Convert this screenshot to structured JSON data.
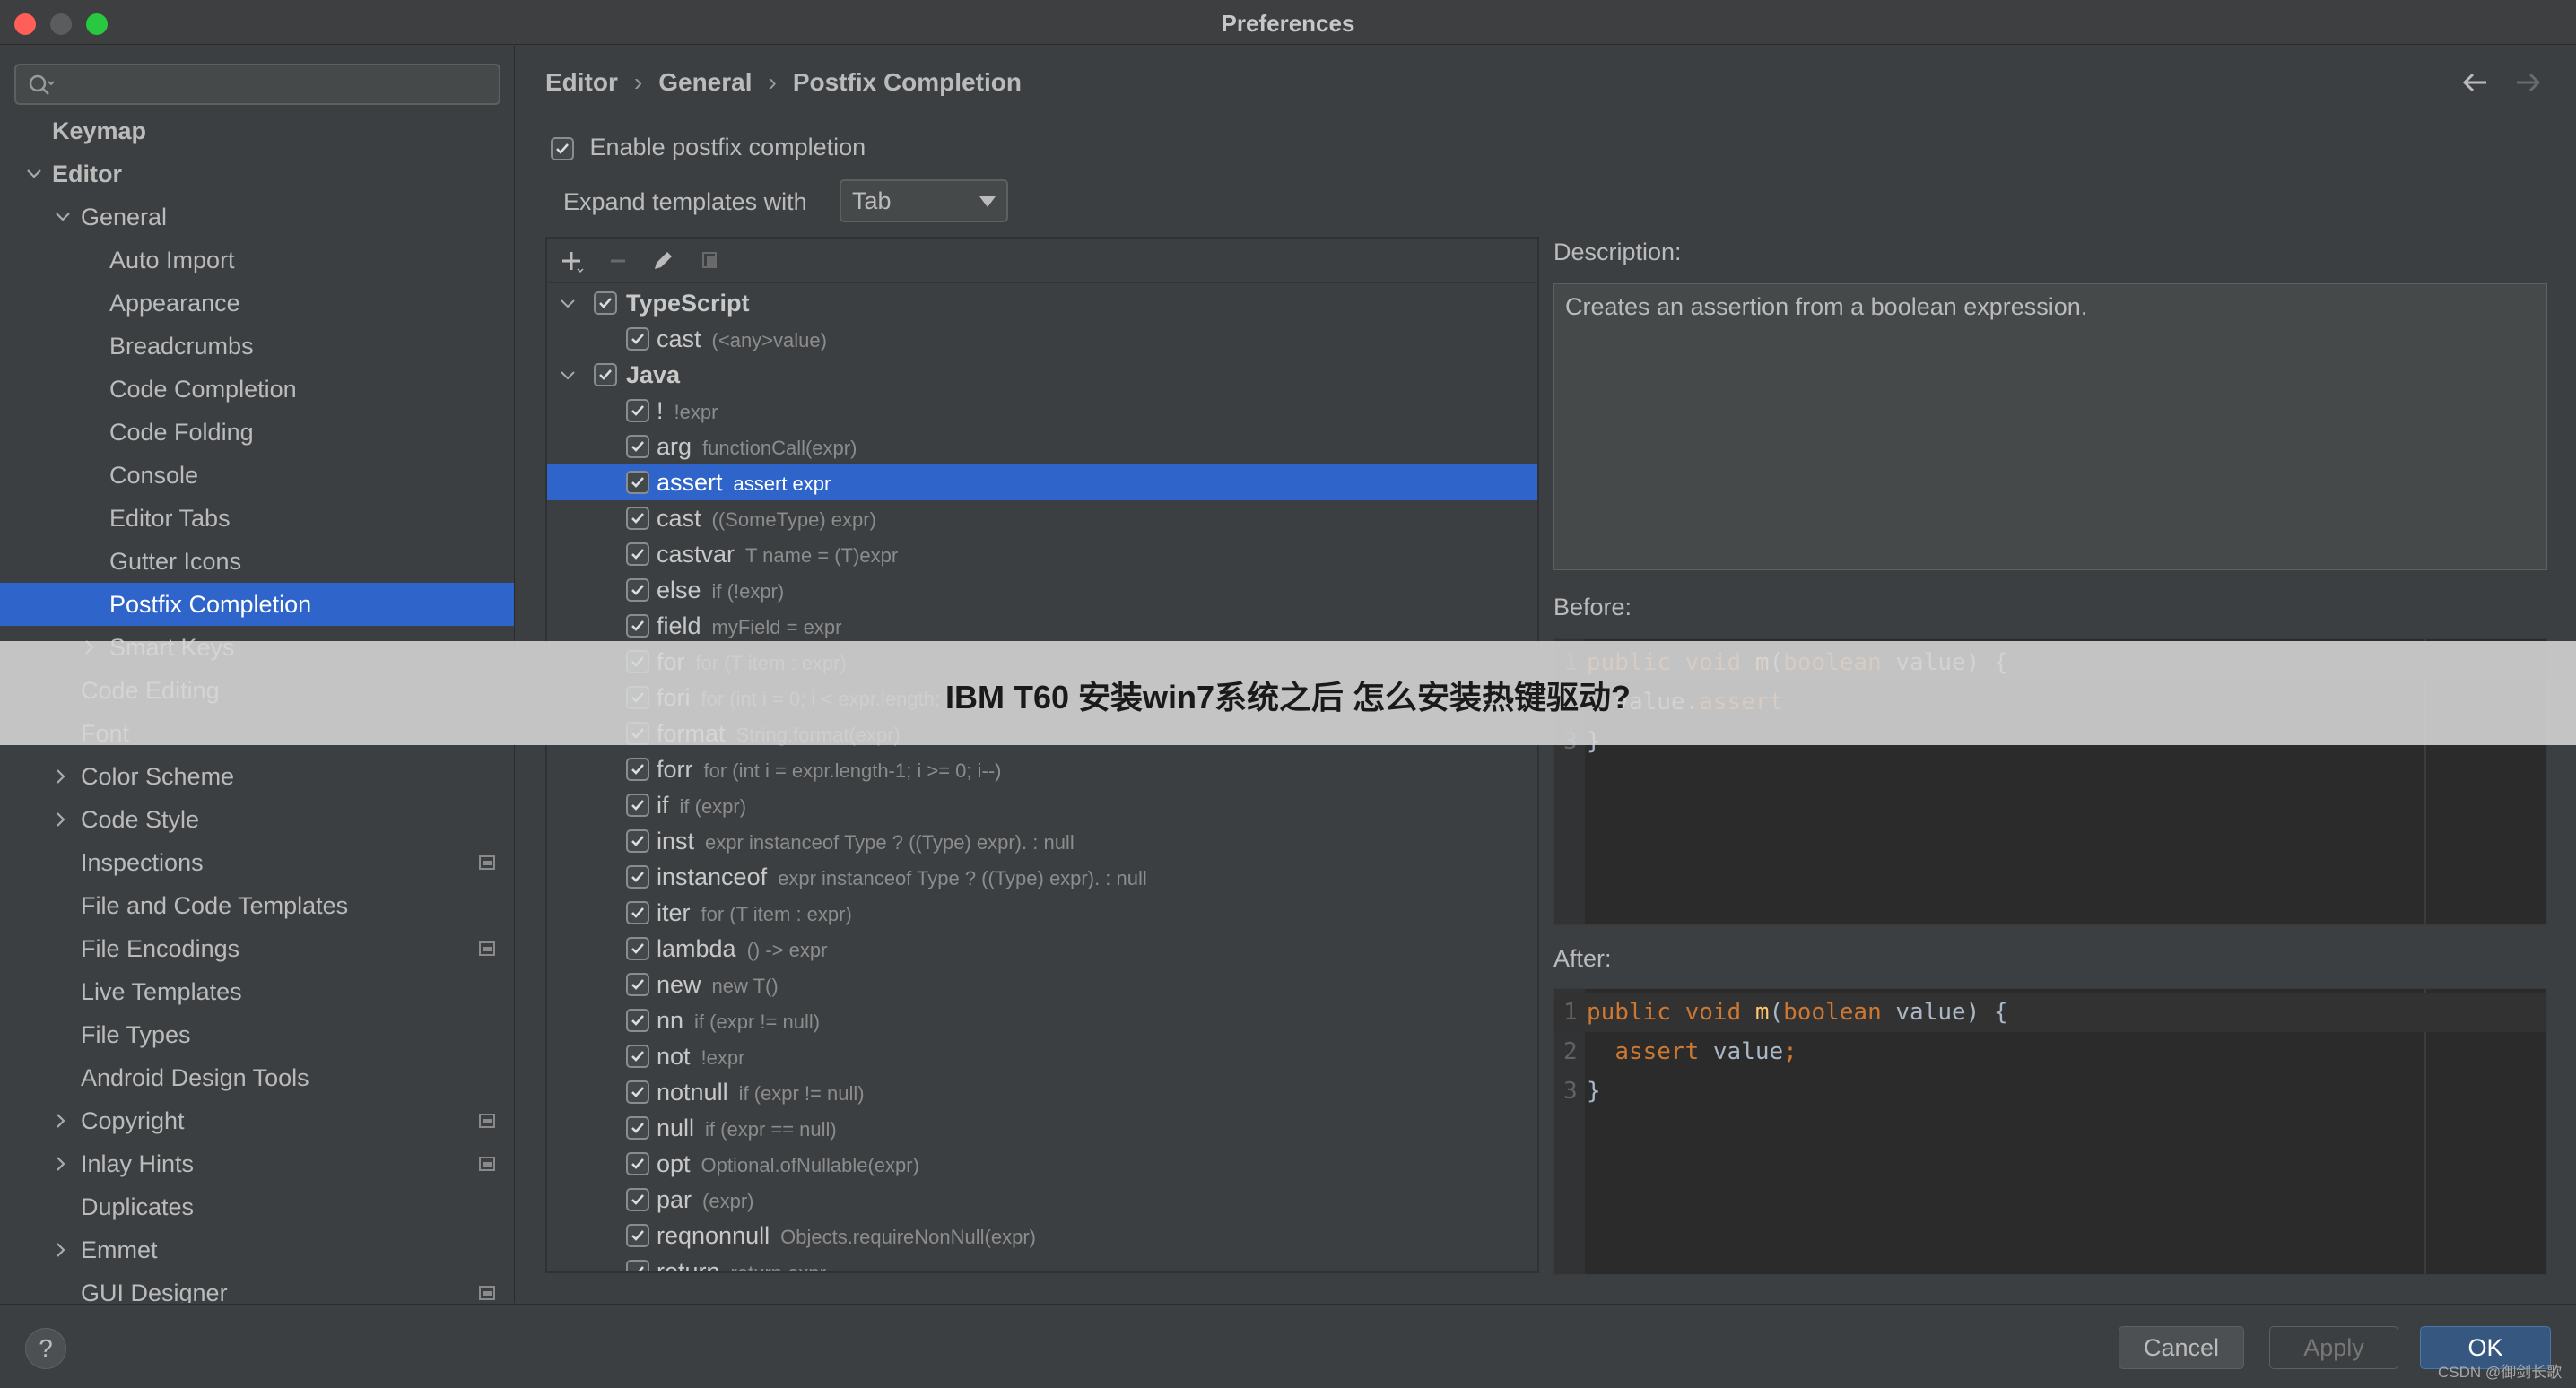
{
  "window": {
    "title": "Preferences"
  },
  "search": {
    "placeholder": ""
  },
  "sidebar": {
    "items": [
      {
        "label": "Keymap",
        "bold": true
      },
      {
        "label": "Editor",
        "bold": true
      },
      {
        "label": "General"
      },
      {
        "label": "Auto Import"
      },
      {
        "label": "Appearance"
      },
      {
        "label": "Breadcrumbs"
      },
      {
        "label": "Code Completion"
      },
      {
        "label": "Code Folding"
      },
      {
        "label": "Console"
      },
      {
        "label": "Editor Tabs"
      },
      {
        "label": "Gutter Icons"
      },
      {
        "label": "Postfix Completion",
        "selected": true
      },
      {
        "label": "Smart Keys"
      },
      {
        "label": "Code Editing"
      },
      {
        "label": "Font"
      },
      {
        "label": "Color Scheme"
      },
      {
        "label": "Code Style"
      },
      {
        "label": "Inspections"
      },
      {
        "label": "File and Code Templates"
      },
      {
        "label": "File Encodings"
      },
      {
        "label": "Live Templates"
      },
      {
        "label": "File Types"
      },
      {
        "label": "Android Design Tools"
      },
      {
        "label": "Copyright"
      },
      {
        "label": "Inlay Hints"
      },
      {
        "label": "Duplicates"
      },
      {
        "label": "Emmet"
      },
      {
        "label": "GUI Designer"
      }
    ]
  },
  "breadcrumb": {
    "items": [
      "Editor",
      "General",
      "Postfix Completion"
    ],
    "separator": "›"
  },
  "settings": {
    "enable_label": "Enable postfix completion",
    "enable_checked": true,
    "expand_label": "Expand templates with",
    "expand_value": "Tab"
  },
  "templates": {
    "groups": [
      {
        "name": "TypeScript",
        "items": [
          {
            "key": "cast",
            "desc": "(<any>value)"
          }
        ]
      },
      {
        "name": "Java",
        "items": [
          {
            "key": "!",
            "desc": "!expr"
          },
          {
            "key": "arg",
            "desc": "functionCall(expr)"
          },
          {
            "key": "assert",
            "desc": "assert expr",
            "selected": true
          },
          {
            "key": "cast",
            "desc": "((SomeType) expr)"
          },
          {
            "key": "castvar",
            "desc": "T name = (T)expr"
          },
          {
            "key": "else",
            "desc": "if (!expr)"
          },
          {
            "key": "field",
            "desc": "myField = expr"
          },
          {
            "key": "for",
            "desc": "for (T item : expr)"
          },
          {
            "key": "fori",
            "desc": "for (int i = 0; i < expr.length; i++)"
          },
          {
            "key": "format",
            "desc": "String.format(expr)"
          },
          {
            "key": "forr",
            "desc": "for (int i = expr.length-1; i >= 0; i--)"
          },
          {
            "key": "if",
            "desc": "if (expr)"
          },
          {
            "key": "inst",
            "desc": "expr instanceof Type ? ((Type) expr). : null"
          },
          {
            "key": "instanceof",
            "desc": "expr instanceof Type ? ((Type) expr). : null"
          },
          {
            "key": "iter",
            "desc": "for (T item : expr)"
          },
          {
            "key": "lambda",
            "desc": "() -> expr"
          },
          {
            "key": "new",
            "desc": "new T()"
          },
          {
            "key": "nn",
            "desc": "if (expr != null)"
          },
          {
            "key": "not",
            "desc": "!expr"
          },
          {
            "key": "notnull",
            "desc": "if (expr != null)"
          },
          {
            "key": "null",
            "desc": "if (expr == null)"
          },
          {
            "key": "opt",
            "desc": "Optional.ofNullable(expr)"
          },
          {
            "key": "par",
            "desc": "(expr)"
          },
          {
            "key": "reqnonnull",
            "desc": "Objects.requireNonNull(expr)"
          },
          {
            "key": "return",
            "desc": "return expr"
          }
        ]
      }
    ]
  },
  "description": {
    "label": "Description:",
    "text": "Creates an assertion from a boolean expression."
  },
  "before": {
    "label": "Before:",
    "lines": [
      {
        "n": "1",
        "parts": [
          [
            "kw",
            "public void "
          ],
          [
            "fn",
            "m"
          ],
          [
            "",
            "("
          ],
          [
            "kw",
            "boolean "
          ],
          [
            "",
            "value) {"
          ]
        ]
      },
      {
        "n": "2",
        "parts": [
          [
            "",
            "  value."
          ],
          [
            "kw",
            "assert"
          ]
        ]
      },
      {
        "n": "3",
        "parts": [
          [
            "",
            "}"
          ]
        ]
      }
    ]
  },
  "after": {
    "label": "After:",
    "lines": [
      {
        "n": "1",
        "parts": [
          [
            "kw",
            "public void "
          ],
          [
            "fn",
            "m"
          ],
          [
            "",
            "("
          ],
          [
            "kw",
            "boolean "
          ],
          [
            "",
            "value) {"
          ]
        ]
      },
      {
        "n": "2",
        "parts": [
          [
            "",
            "  "
          ],
          [
            "kw",
            "assert "
          ],
          [
            "",
            "value"
          ],
          [
            "kw",
            ";"
          ]
        ]
      },
      {
        "n": "3",
        "parts": [
          [
            "",
            "}"
          ]
        ]
      }
    ]
  },
  "buttons": {
    "help": "?",
    "cancel": "Cancel",
    "apply": "Apply",
    "ok": "OK"
  },
  "overlay": {
    "text": "IBM T60 安装win7系统之后 怎么安装热键驱动?"
  },
  "watermark": "CSDN @御剑长歌",
  "colors": {
    "accent": "#2f65ca",
    "keyword": "#cc7832",
    "function": "#ffc66d",
    "ok_button": "#365880"
  }
}
